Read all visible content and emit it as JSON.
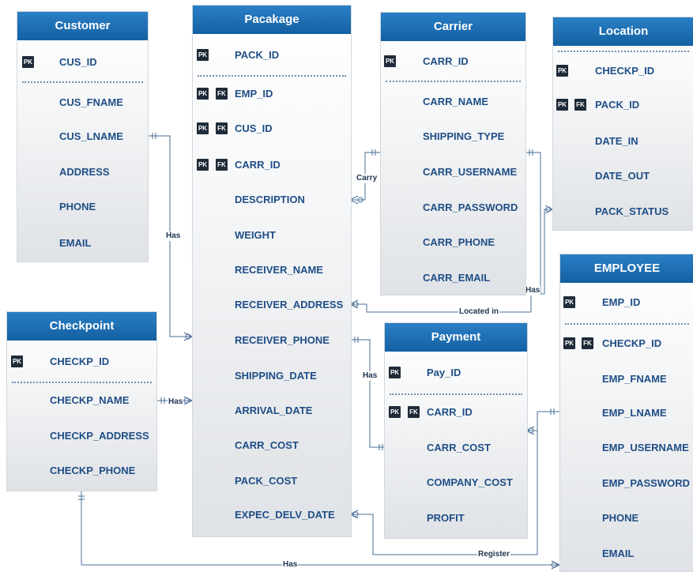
{
  "entities": {
    "customer": {
      "title": "Customer",
      "pk": {
        "badges": [
          "PK"
        ],
        "name": "CUS_ID"
      },
      "fields": [
        {
          "badges": [],
          "name": "CUS_FNAME"
        },
        {
          "badges": [],
          "name": "CUS_LNAME"
        },
        {
          "badges": [],
          "name": "ADDRESS"
        },
        {
          "badges": [],
          "name": "PHONE"
        },
        {
          "badges": [],
          "name": "EMAIL"
        }
      ]
    },
    "package": {
      "title": "Pacakage",
      "pk": {
        "badges": [
          "PK"
        ],
        "name": "PACK_ID"
      },
      "fields": [
        {
          "badges": [
            "PK",
            "FK"
          ],
          "name": "EMP_ID"
        },
        {
          "badges": [
            "PK",
            "FK"
          ],
          "name": "CUS_ID"
        },
        {
          "badges": [
            "PK",
            "FK"
          ],
          "name": "CARR_ID"
        },
        {
          "badges": [],
          "name": "DESCRIPTION"
        },
        {
          "badges": [],
          "name": "WEIGHT"
        },
        {
          "badges": [],
          "name": "RECEIVER_NAME"
        },
        {
          "badges": [],
          "name": "RECEIVER_ADDRESS"
        },
        {
          "badges": [],
          "name": "RECEIVER_PHONE"
        },
        {
          "badges": [],
          "name": "SHIPPING_DATE"
        },
        {
          "badges": [],
          "name": "ARRIVAL_DATE"
        },
        {
          "badges": [],
          "name": "CARR_COST"
        },
        {
          "badges": [],
          "name": "PACK_COST"
        },
        {
          "badges": [],
          "name": "EXPEC_DELV_DATE"
        }
      ]
    },
    "carrier": {
      "title": "Carrier",
      "pk": {
        "badges": [
          "PK"
        ],
        "name": "CARR_ID"
      },
      "fields": [
        {
          "badges": [],
          "name": "CARR_NAME"
        },
        {
          "badges": [],
          "name": "SHIPPING_TYPE"
        },
        {
          "badges": [],
          "name": "CARR_USERNAME"
        },
        {
          "badges": [],
          "name": "CARR_PASSWORD"
        },
        {
          "badges": [],
          "name": "CARR_PHONE"
        },
        {
          "badges": [],
          "name": "CARR_EMAIL"
        }
      ]
    },
    "location": {
      "title": "Location",
      "pk": {
        "badges": [
          "PK"
        ],
        "name": "CHECKP_ID"
      },
      "fields": [
        {
          "badges": [
            "PK",
            "FK"
          ],
          "name": "PACK_ID"
        },
        {
          "badges": [],
          "name": "DATE_IN"
        },
        {
          "badges": [],
          "name": "DATE_OUT"
        },
        {
          "badges": [],
          "name": "PACK_STATUS"
        }
      ]
    },
    "checkpoint": {
      "title": "Checkpoint",
      "pk": {
        "badges": [
          "PK"
        ],
        "name": "CHECKP_ID"
      },
      "fields": [
        {
          "badges": [],
          "name": "CHECKP_NAME"
        },
        {
          "badges": [],
          "name": "CHECKP_ADDRESS"
        },
        {
          "badges": [],
          "name": "CHECKP_PHONE"
        }
      ]
    },
    "payment": {
      "title": "Payment",
      "pk": {
        "badges": [
          "PK"
        ],
        "name": "Pay_ID"
      },
      "fields": [
        {
          "badges": [
            "PK",
            "FK"
          ],
          "name": "CARR_ID"
        },
        {
          "badges": [],
          "name": "CARR_COST"
        },
        {
          "badges": [],
          "name": "COMPANY_COST"
        },
        {
          "badges": [],
          "name": "PROFIT"
        }
      ]
    },
    "employee": {
      "title": "EMPLOYEE",
      "pk": {
        "badges": [
          "PK"
        ],
        "name": "EMP_ID"
      },
      "fields": [
        {
          "badges": [
            "PK",
            "FK"
          ],
          "name": "CHECKP_ID"
        },
        {
          "badges": [],
          "name": "EMP_FNAME"
        },
        {
          "badges": [],
          "name": "EMP_LNAME"
        },
        {
          "badges": [],
          "name": "EMP_USERNAME"
        },
        {
          "badges": [],
          "name": "EMP_PASSWORD"
        },
        {
          "badges": [],
          "name": "PHONE"
        },
        {
          "badges": [],
          "name": "EMAIL"
        }
      ]
    }
  },
  "relationships": {
    "customer_package": "Has",
    "carrier_package": "Carry",
    "checkpoint_package": "Has",
    "carrier_location": "Has",
    "location_package": "Located in",
    "package_payment": "Has",
    "employee_package": "Register",
    "checkpoint_employee": "Has"
  }
}
